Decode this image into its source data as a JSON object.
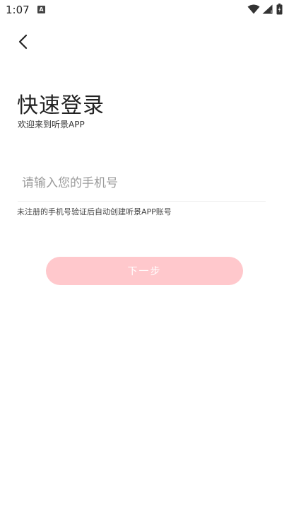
{
  "status_bar": {
    "time": "1:07",
    "notification_icon_letter": "A"
  },
  "login": {
    "title": "快速登录",
    "subtitle": "欢迎来到听景APP",
    "phone_placeholder": "请输入您的手机号",
    "phone_value": "",
    "hint": "未注册的手机号验证后自动创建听景APP账号",
    "next_label": "下一步"
  },
  "colors": {
    "next_button_bg": "#ffc8cc",
    "next_button_text": "#ffffff",
    "title_text": "#222222",
    "placeholder_text": "#9a9a9a",
    "divider": "#eeeeee"
  },
  "icons": {
    "back": "chevron-left-icon",
    "wifi": "wifi-icon",
    "signal": "cell-signal-icon",
    "battery": "battery-icon"
  }
}
